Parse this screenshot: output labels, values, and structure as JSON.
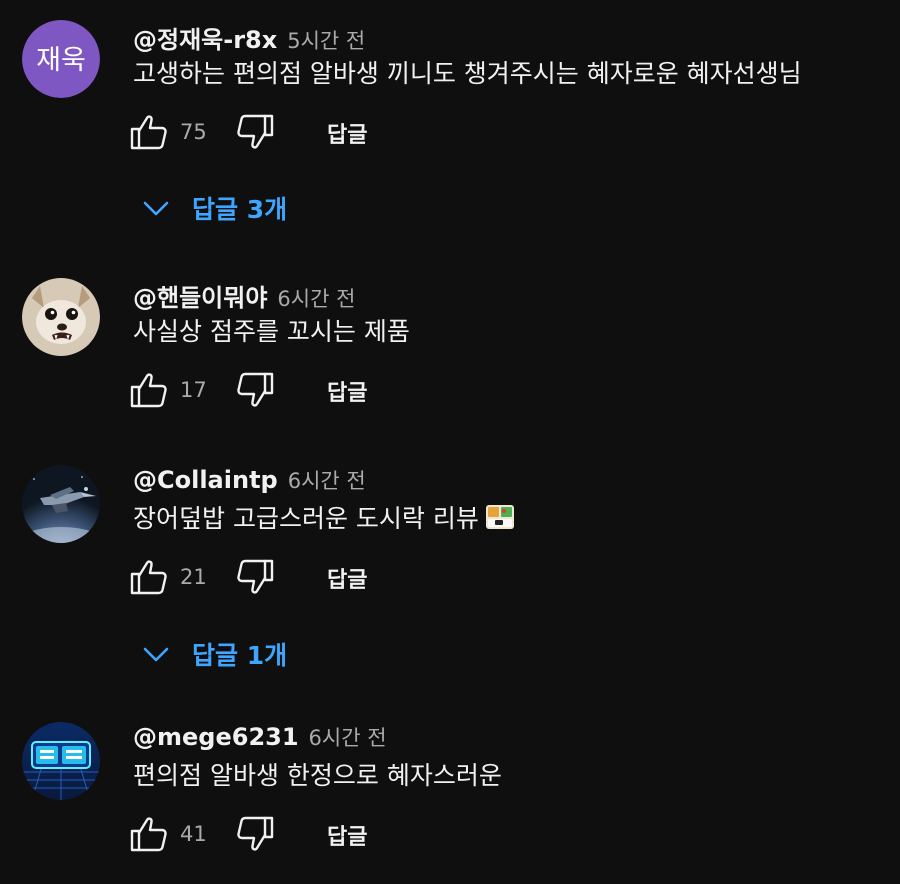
{
  "comments": [
    {
      "author": "@정재욱-r8x",
      "time": "5시간 전",
      "text": "고생하는 편의점 알바생 끼니도 챙겨주시는 혜자로운 혜자선생님",
      "avatar_initials": "재욱",
      "avatar_color": "#7e57c2",
      "likes": "75",
      "reply_label": "답글",
      "replies_label": "답글 3개"
    },
    {
      "author": "@핸들이뭐야",
      "time": "6시간 전",
      "text": "사실상 점주를 꼬시는 제품",
      "avatar_icon": "chihuahua-photo",
      "likes": "17",
      "reply_label": "답글"
    },
    {
      "author": "@Collaintp",
      "time": "6시간 전",
      "text": "장어덮밥 고급스러운 도시락 리뷰",
      "text_emoji": "bento-box-icon",
      "avatar_icon": "spaceship-photo",
      "likes": "21",
      "reply_label": "답글",
      "replies_label": "답글 1개"
    },
    {
      "author": "@mege6231",
      "time": "6시간 전",
      "text": "편의점 알바생 한정으로 혜자스러운",
      "avatar_icon": "neon-sign-photo",
      "likes": "41",
      "reply_label": "답글"
    }
  ],
  "colors": {
    "background": "#0f0f0f",
    "text_primary": "#f1f1f1",
    "text_secondary": "#aaaaaa",
    "link_blue": "#3ea6ff"
  }
}
